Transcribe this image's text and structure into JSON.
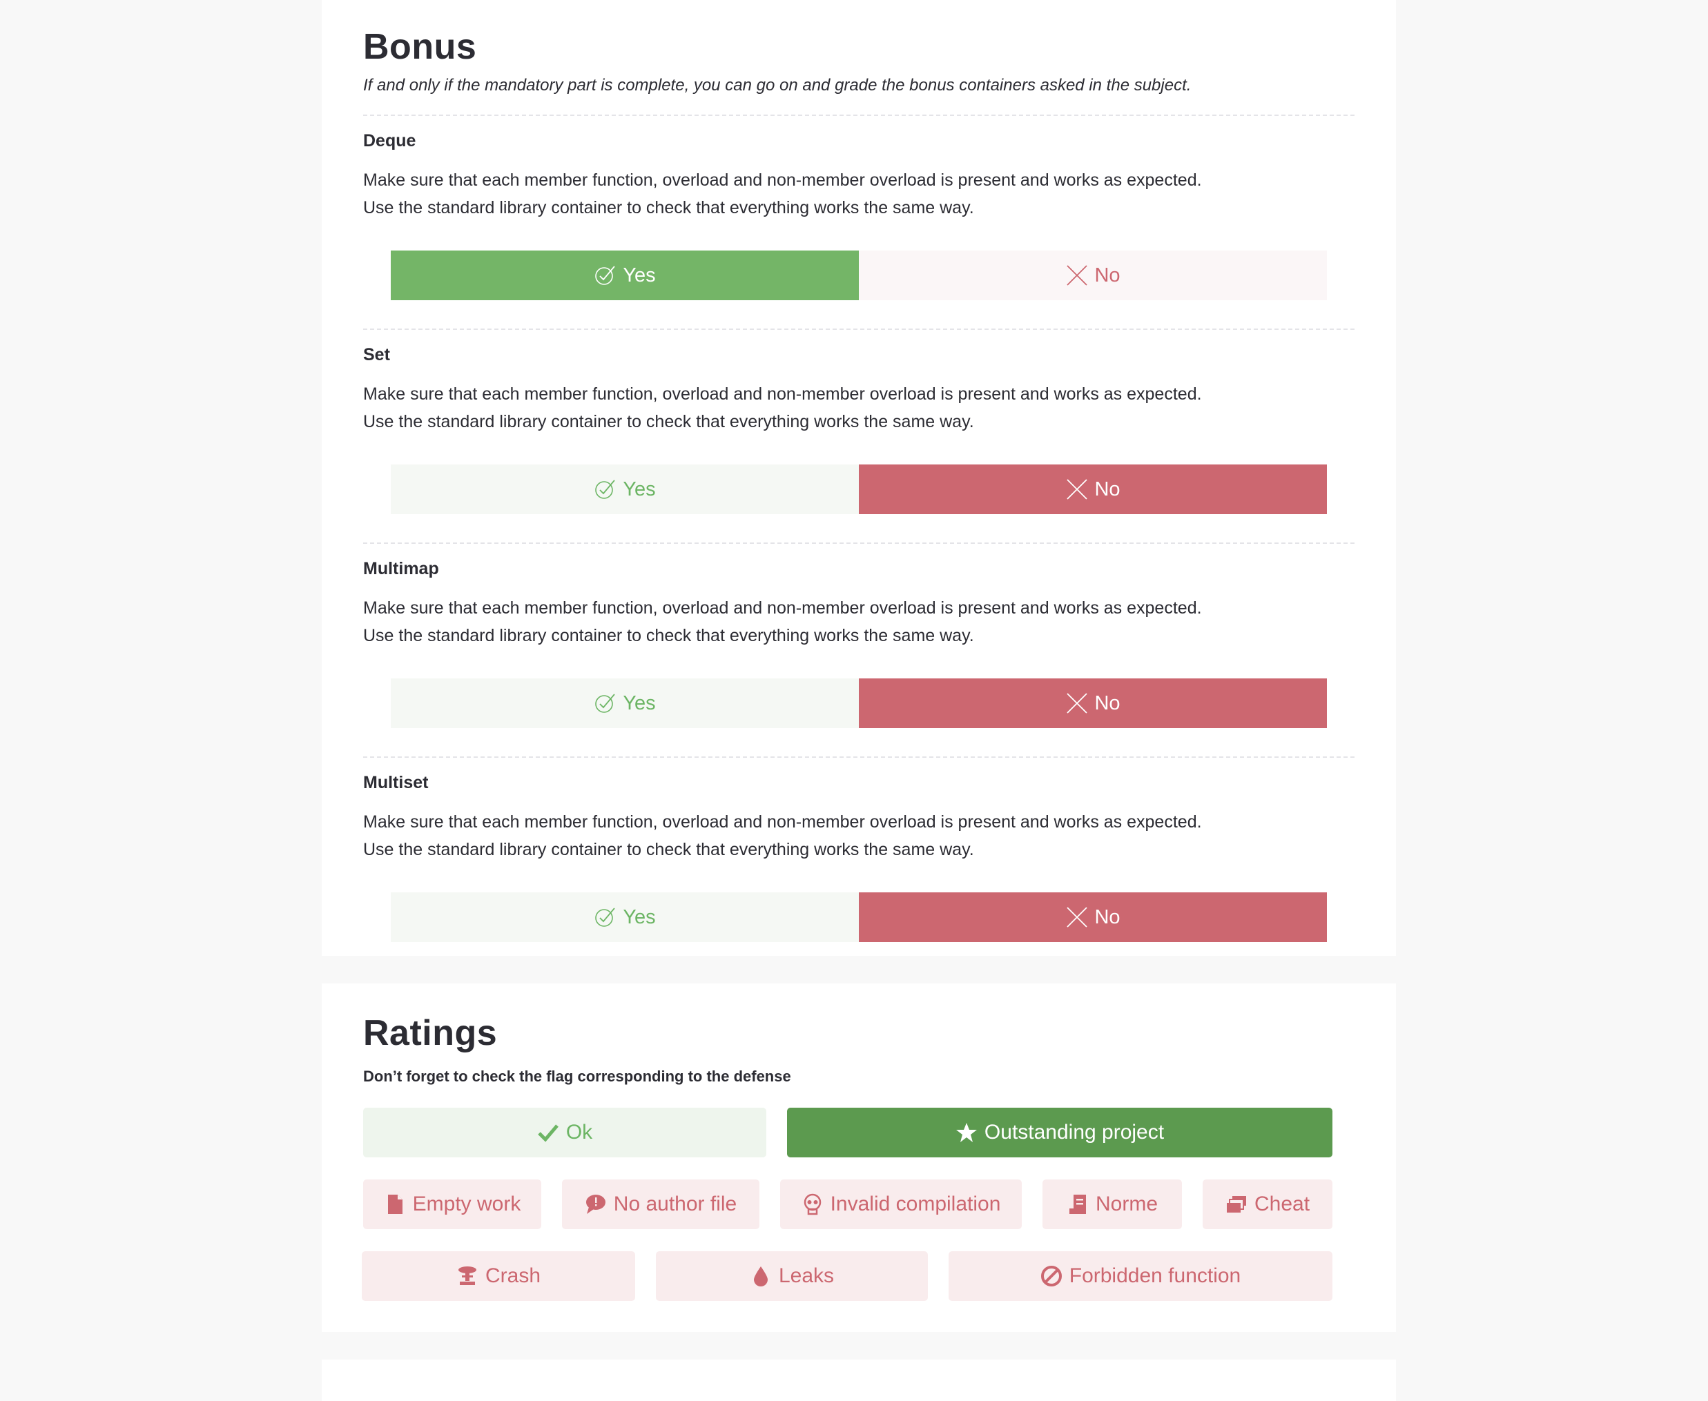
{
  "bonus": {
    "title": "Bonus",
    "subtitle": "If and only if the mandatory part is complete, you can go on and grade the bonus containers asked in the subject.",
    "sections": [
      {
        "title": "Deque",
        "description": "Make sure that each member function, overload and non-member overload is present and works as expected.\nUse the standard library container to check that everything works the same way.",
        "yes_label": "Yes",
        "no_label": "No",
        "selected": "yes"
      },
      {
        "title": "Set",
        "description": "Make sure that each member function, overload and non-member overload is present and works as expected.\nUse the standard library container to check that everything works the same way.",
        "yes_label": "Yes",
        "no_label": "No",
        "selected": "no"
      },
      {
        "title": "Multimap",
        "description": "Make sure that each member function, overload and non-member overload is present and works as expected.\nUse the standard library container to check that everything works the same way.",
        "yes_label": "Yes",
        "no_label": "No",
        "selected": "no"
      },
      {
        "title": "Multiset",
        "description": "Make sure that each member function, overload and non-member overload is present and works as expected.\nUse the standard library container to check that everything works the same way.",
        "yes_label": "Yes",
        "no_label": "No",
        "selected": "no"
      }
    ]
  },
  "ratings": {
    "title": "Ratings",
    "note": "Don’t forget to check the flag corresponding to the defense",
    "ok_label": "Ok",
    "outstanding_label": "Outstanding project",
    "selected": "outstanding",
    "flags": [
      {
        "label": "Empty work",
        "icon": "file-icon"
      },
      {
        "label": "No author file",
        "icon": "speech-bubble-icon"
      },
      {
        "label": "Invalid compilation",
        "icon": "skull-icon"
      },
      {
        "label": "Norme",
        "icon": "norme-icon"
      },
      {
        "label": "Cheat",
        "icon": "cheat-icon"
      },
      {
        "label": "Crash",
        "icon": "crash-icon"
      },
      {
        "label": "Leaks",
        "icon": "drop-icon"
      },
      {
        "label": "Forbidden function",
        "icon": "forbidden-icon"
      }
    ]
  },
  "colors": {
    "yes_active": "#74b567",
    "no_active": "#cc6770",
    "outstanding": "#5c9a4f"
  }
}
